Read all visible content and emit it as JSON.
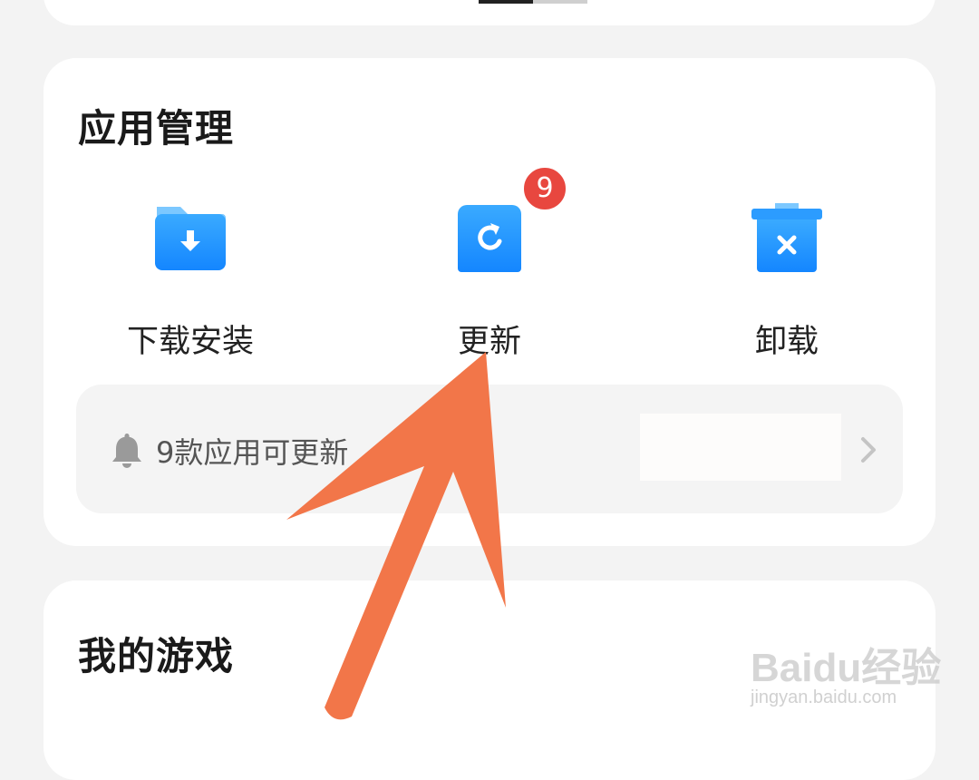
{
  "manage": {
    "title": "应用管理",
    "actions": [
      {
        "label": "下载安装",
        "icon": "folder-download-icon"
      },
      {
        "label": "更新",
        "icon": "refresh-icon",
        "badge": "9"
      },
      {
        "label": "卸载",
        "icon": "trash-uninstall-icon"
      }
    ],
    "notice": {
      "text": "9款应用可更新"
    }
  },
  "games": {
    "title": "我的游戏"
  },
  "watermark": {
    "logo": "Baidu经验",
    "url": "jingyan.baidu.com"
  },
  "colors": {
    "accent_blue": "#1a90ff",
    "badge_red": "#e8473f",
    "annotation_arrow": "#f27649"
  }
}
